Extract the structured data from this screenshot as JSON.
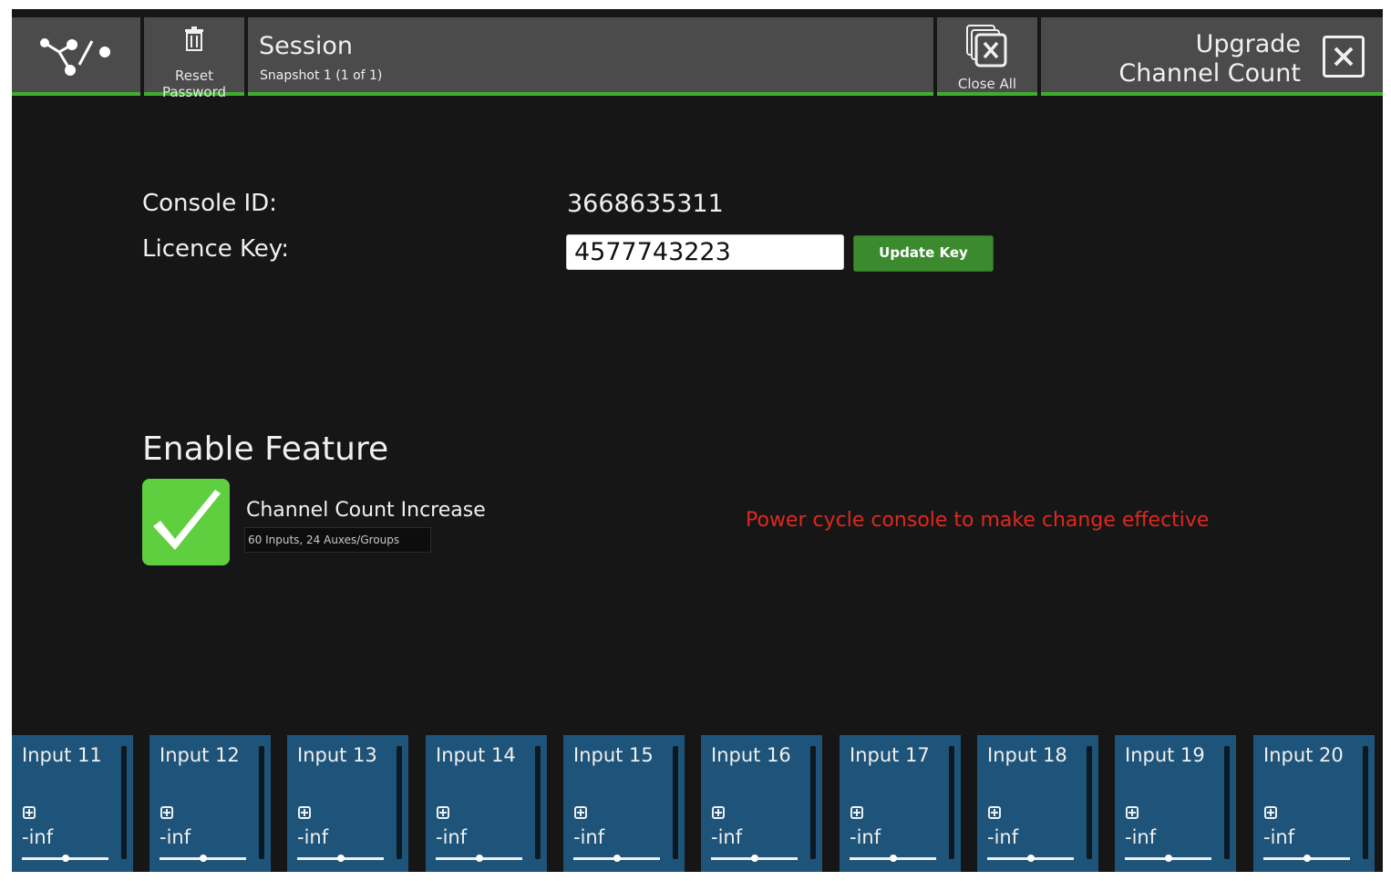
{
  "header": {
    "logo_icon": "routing-logo-icon",
    "reset_label_line1": "Reset",
    "reset_label_line2": "Password",
    "session_title": "Session",
    "session_subtitle": "Snapshot 1 (1 of 1)",
    "close_all_label": "Close All",
    "upgrade_line1": "Upgrade",
    "upgrade_line2": "Channel Count",
    "accent_color": "#3fae2f"
  },
  "licence": {
    "console_id_label": "Console ID:",
    "console_id_value": "3668635311",
    "licence_key_label": "Licence Key:",
    "licence_key_value": "4577743223",
    "update_button_label": "Update Key"
  },
  "feature": {
    "heading": "Enable Feature",
    "checked": true,
    "name": "Channel Count Increase",
    "description": "60 Inputs, 24 Auxes/Groups",
    "notice": "Power cycle console to make change effective",
    "notice_color": "#e0281d"
  },
  "channels": [
    {
      "name": "Input 11",
      "level": "-inf"
    },
    {
      "name": "Input 12",
      "level": "-inf"
    },
    {
      "name": "Input 13",
      "level": "-inf"
    },
    {
      "name": "Input 14",
      "level": "-inf"
    },
    {
      "name": "Input 15",
      "level": "-inf"
    },
    {
      "name": "Input 16",
      "level": "-inf"
    },
    {
      "name": "Input 17",
      "level": "-inf"
    },
    {
      "name": "Input 18",
      "level": "-inf"
    },
    {
      "name": "Input 19",
      "level": "-inf"
    },
    {
      "name": "Input 20",
      "level": "-inf"
    }
  ]
}
